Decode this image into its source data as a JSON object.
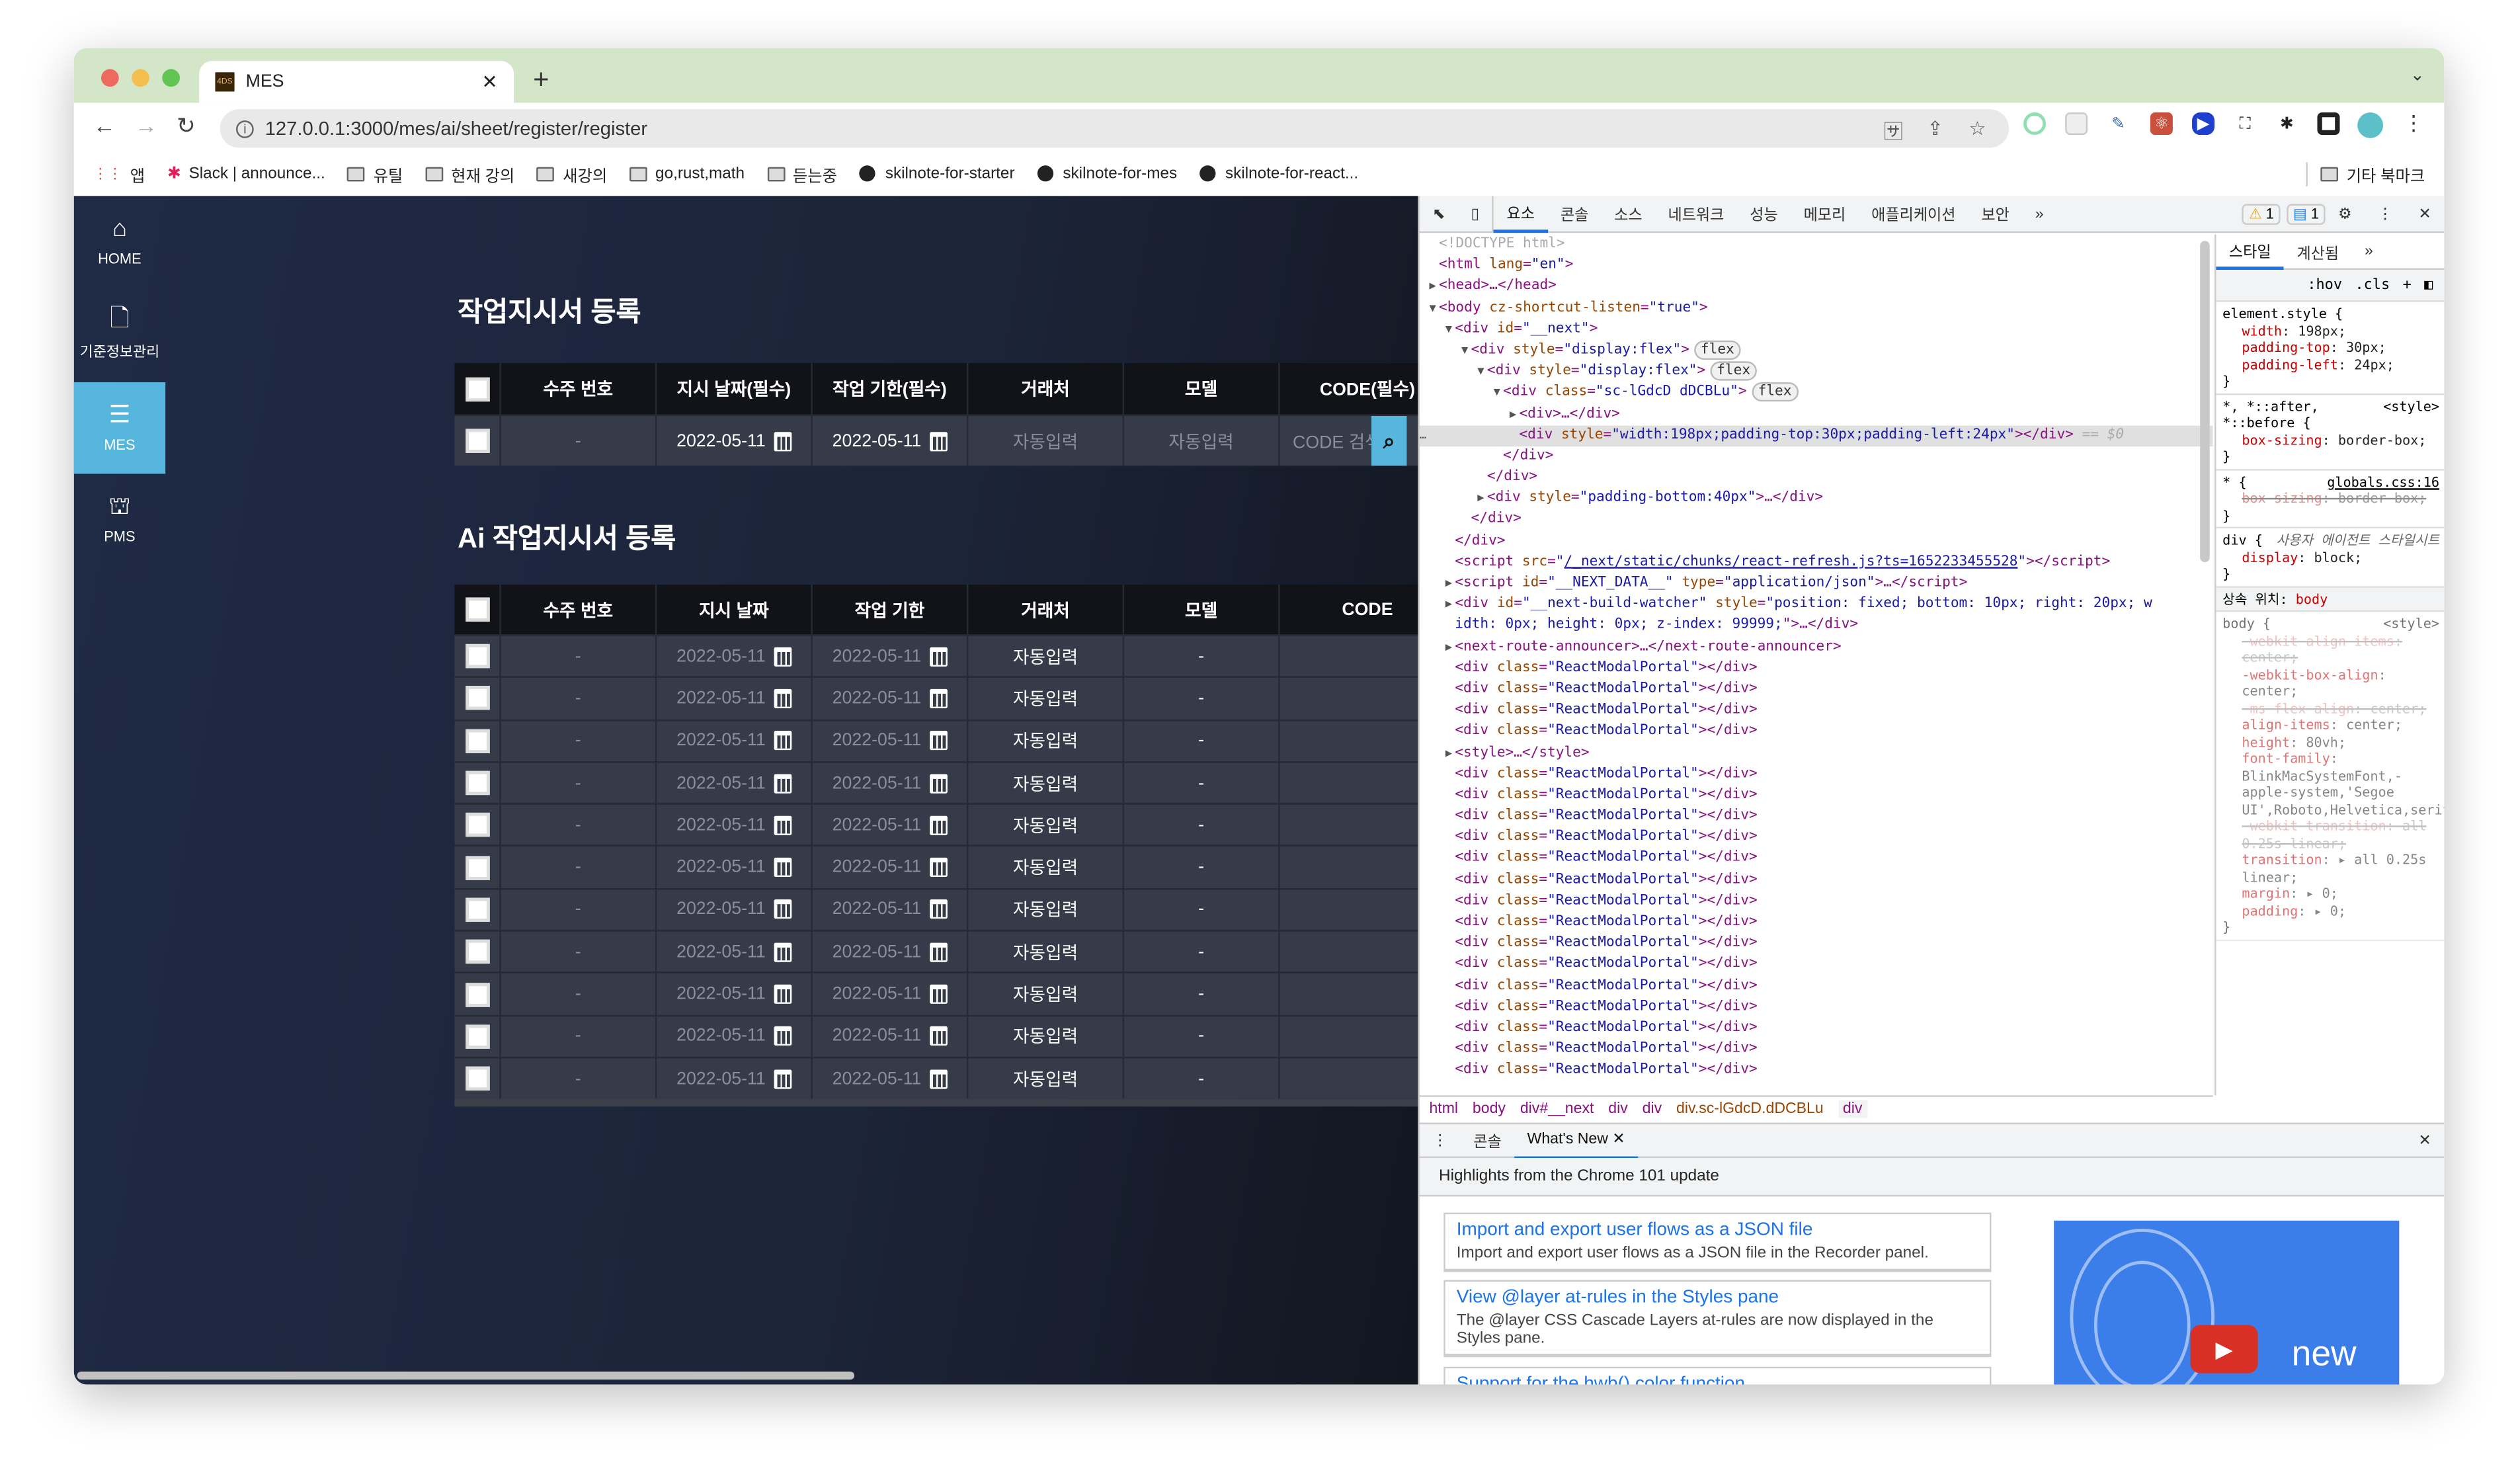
{
  "browser": {
    "tab_title": "MES",
    "favicon_text": "4DS",
    "url": "127.0.0.1:3000/mes/ai/sheet/register/register",
    "bookmarks": [
      {
        "label": "앱",
        "icon": "apps-icon"
      },
      {
        "label": "Slack | announce...",
        "icon": "slack-icon"
      },
      {
        "label": "유틸",
        "icon": "folder-icon"
      },
      {
        "label": "현재 강의",
        "icon": "folder-icon"
      },
      {
        "label": "새강의",
        "icon": "folder-icon"
      },
      {
        "label": "go,rust,math",
        "icon": "folder-icon"
      },
      {
        "label": "듣는중",
        "icon": "folder-icon"
      },
      {
        "label": "skilnote-for-starter",
        "icon": "github-icon"
      },
      {
        "label": "skilnote-for-mes",
        "icon": "github-icon"
      },
      {
        "label": "skilnote-for-react...",
        "icon": "github-icon"
      }
    ],
    "other_bookmarks": "기타 북마크"
  },
  "sidebar": {
    "items": [
      {
        "label": "HOME",
        "icon": "⌂"
      },
      {
        "label": "기준정보관리",
        "icon": "🗋"
      },
      {
        "label": "MES",
        "icon": "☰"
      },
      {
        "label": "PMS",
        "icon": "⛫"
      }
    ],
    "active": "MES",
    "accent": "#56b6dd"
  },
  "section1": {
    "title": "작업지시서 등록",
    "headers": [
      "수주 번호",
      "지시 날짜(필수)",
      "작업 기한(필수)",
      "거래처",
      "모델",
      "CODE(필수)"
    ],
    "row": {
      "order_no": "-",
      "date": "2022-05-11",
      "deadline": "2022-05-11",
      "client": "자동입력",
      "model": "자동입력",
      "code_placeholder": "CODE 검색"
    }
  },
  "section2": {
    "title": "Ai 작업지시서 등록",
    "headers": [
      "수주 번호",
      "지시 날짜",
      "작업 기한",
      "거래처",
      "모델",
      "CODE"
    ],
    "rows": [
      {
        "order_no": "-",
        "date": "2022-05-11",
        "deadline": "2022-05-11",
        "client": "자동입력",
        "model": "-",
        "code": ""
      },
      {
        "order_no": "-",
        "date": "2022-05-11",
        "deadline": "2022-05-11",
        "client": "자동입력",
        "model": "-",
        "code": ""
      },
      {
        "order_no": "-",
        "date": "2022-05-11",
        "deadline": "2022-05-11",
        "client": "자동입력",
        "model": "-",
        "code": ""
      },
      {
        "order_no": "-",
        "date": "2022-05-11",
        "deadline": "2022-05-11",
        "client": "자동입력",
        "model": "-",
        "code": ""
      },
      {
        "order_no": "-",
        "date": "2022-05-11",
        "deadline": "2022-05-11",
        "client": "자동입력",
        "model": "-",
        "code": ""
      },
      {
        "order_no": "-",
        "date": "2022-05-11",
        "deadline": "2022-05-11",
        "client": "자동입력",
        "model": "-",
        "code": ""
      },
      {
        "order_no": "-",
        "date": "2022-05-11",
        "deadline": "2022-05-11",
        "client": "자동입력",
        "model": "-",
        "code": ""
      },
      {
        "order_no": "-",
        "date": "2022-05-11",
        "deadline": "2022-05-11",
        "client": "자동입력",
        "model": "-",
        "code": ""
      },
      {
        "order_no": "-",
        "date": "2022-05-11",
        "deadline": "2022-05-11",
        "client": "자동입력",
        "model": "-",
        "code": ""
      },
      {
        "order_no": "-",
        "date": "2022-05-11",
        "deadline": "2022-05-11",
        "client": "자동입력",
        "model": "-",
        "code": ""
      },
      {
        "order_no": "-",
        "date": "2022-05-11",
        "deadline": "2022-05-11",
        "client": "자동입력",
        "model": "-",
        "code": ""
      }
    ]
  },
  "devtools": {
    "tabs": [
      "요소",
      "콘솔",
      "소스",
      "네트워크",
      "성능",
      "메모리",
      "애플리케이션",
      "보안",
      "»"
    ],
    "active_tab": "요소",
    "warnings": "1",
    "messages": "1",
    "dom_lines": [
      {
        "i": 0,
        "t": "<!DOCTYPE html>",
        "c": 1
      },
      {
        "i": 0,
        "t": "<html lang=\"en\">"
      },
      {
        "i": 0,
        "a": "▶",
        "t": "<head>…</head>"
      },
      {
        "i": 0,
        "a": "▼",
        "t": "<body cz-shortcut-listen=\"true\">"
      },
      {
        "i": 1,
        "a": "▼",
        "t": "<div id=\"__next\">"
      },
      {
        "i": 2,
        "a": "▼",
        "t": "<div style=\"display:flex\">",
        "f": "flex"
      },
      {
        "i": 3,
        "a": "▼",
        "t": "<div style=\"display:flex\">",
        "f": "flex"
      },
      {
        "i": 4,
        "a": "▼",
        "t": "<div class=\"sc-lGdcD dDCBLu\">",
        "f": "flex"
      },
      {
        "i": 5,
        "a": "▶",
        "t": "<div>…</div>"
      },
      {
        "i": 5,
        "t": "<div style=\"width:198px;padding-top:30px;padding-left:24px\"></div>",
        "s": " == $0",
        "sel": 1
      },
      {
        "i": 4,
        "t": "</div>"
      },
      {
        "i": 3,
        "t": "</div>"
      },
      {
        "i": 3,
        "a": "▶",
        "t": "<div style=\"padding-bottom:40px\">…</div>"
      },
      {
        "i": 2,
        "t": "</div>"
      },
      {
        "i": 1,
        "t": "</div>"
      },
      {
        "i": 1,
        "t": "<script src=\"/_next/static/chunks/react-refresh.js?ts=1652233455528\"></script>"
      },
      {
        "i": 1,
        "a": "▶",
        "t": "<script id=\"__NEXT_DATA__\" type=\"application/json\">…</script>"
      },
      {
        "i": 1,
        "a": "▶",
        "t": "<div id=\"__next-build-watcher\" style=\"position: fixed; bottom: 10px; right: 20px; w"
      },
      {
        "i": 1,
        "t": "idth: 0px; height: 0px; z-index: 99999;\">…</div>",
        "v": 1
      },
      {
        "i": 1,
        "a": "▶",
        "t": "<next-route-announcer>…</next-route-announcer>"
      },
      {
        "i": 1,
        "t": "<div class=\"ReactModalPortal\"></div>"
      },
      {
        "i": 1,
        "t": "<div class=\"ReactModalPortal\"></div>"
      },
      {
        "i": 1,
        "t": "<div class=\"ReactModalPortal\"></div>"
      },
      {
        "i": 1,
        "t": "<div class=\"ReactModalPortal\"></div>"
      },
      {
        "i": 1,
        "a": "▶",
        "t": "<style>…</style>"
      },
      {
        "i": 1,
        "t": "<div class=\"ReactModalPortal\"></div>"
      },
      {
        "i": 1,
        "t": "<div class=\"ReactModalPortal\"></div>"
      },
      {
        "i": 1,
        "t": "<div class=\"ReactModalPortal\"></div>"
      },
      {
        "i": 1,
        "t": "<div class=\"ReactModalPortal\"></div>"
      },
      {
        "i": 1,
        "t": "<div class=\"ReactModalPortal\"></div>"
      },
      {
        "i": 1,
        "t": "<div class=\"ReactModalPortal\"></div>"
      },
      {
        "i": 1,
        "t": "<div class=\"ReactModalPortal\"></div>"
      },
      {
        "i": 1,
        "t": "<div class=\"ReactModalPortal\"></div>"
      },
      {
        "i": 1,
        "t": "<div class=\"ReactModalPortal\"></div>"
      },
      {
        "i": 1,
        "t": "<div class=\"ReactModalPortal\"></div>"
      },
      {
        "i": 1,
        "t": "<div class=\"ReactModalPortal\"></div>"
      },
      {
        "i": 1,
        "t": "<div class=\"ReactModalPortal\"></div>"
      },
      {
        "i": 1,
        "t": "<div class=\"ReactModalPortal\"></div>"
      },
      {
        "i": 1,
        "t": "<div class=\"ReactModalPortal\"></div>"
      },
      {
        "i": 1,
        "t": "<div class=\"ReactModalPortal\"></div>"
      }
    ],
    "styles_tabs": [
      "스타일",
      "계산됨",
      "»"
    ],
    "styles_filter": [
      ":hov",
      ".cls",
      "+"
    ],
    "style_rules": [
      {
        "sel": "element.style {",
        "src": "",
        "props": [
          [
            "width",
            "198px;"
          ],
          [
            "padding-top",
            "30px;"
          ],
          [
            "padding-left",
            "24px;"
          ]
        ]
      },
      {
        "sel": "*, *::after, *::before {",
        "src": "<style>",
        "props": [
          [
            "box-sizing",
            "border-box;"
          ]
        ]
      },
      {
        "sel": "* {",
        "src": "globals.css:16",
        "props": [
          [
            "box-sizing",
            "border-box;",
            "x"
          ]
        ]
      },
      {
        "sel": "div {",
        "src": "사용자 에이전트 스타일시트",
        "props": [
          [
            "display",
            "block;"
          ]
        ]
      }
    ],
    "inherited_label": "상속 위치:",
    "inherited_from": "body",
    "body_rule": {
      "sel": "body {",
      "src": "<style>",
      "props": [
        [
          "-webkit-align-items",
          "center;",
          "x"
        ],
        [
          "-webkit-box-align",
          "center;"
        ],
        [
          "-ms-flex-align",
          "center;",
          "x"
        ],
        [
          "align-items",
          "center;"
        ],
        [
          "height",
          "80vh;"
        ],
        [
          "font-family",
          "BlinkMacSystemFont,-apple-system,'Segoe UI',Roboto,Helvetica,serif;"
        ],
        [
          "-webkit-transition",
          "all 0.25s linear;",
          "x"
        ],
        [
          "transition",
          "▸ all 0.25s linear;"
        ],
        [
          "margin",
          "▸ 0;"
        ],
        [
          "padding",
          "▸ 0;"
        ]
      ]
    },
    "breadcrumb": [
      "html",
      "body",
      "div#__next",
      "div",
      "div",
      "div.sc-lGdcD.dDCBLu",
      "div"
    ],
    "drawer_tabs": [
      "콘솔",
      "What's New"
    ],
    "highlights": "Highlights from the Chrome 101 update",
    "cards": [
      {
        "title": "Import and export user flows as a JSON file",
        "desc": "Import and export user flows as a JSON file in the Recorder panel."
      },
      {
        "title": "View @layer at-rules in the Styles pane",
        "desc": "The @layer CSS Cascade Layers at-rules are now displayed in the Styles pane."
      },
      {
        "title": "Support for the hwb() color function",
        "desc": ""
      }
    ],
    "promo_text": "new"
  }
}
